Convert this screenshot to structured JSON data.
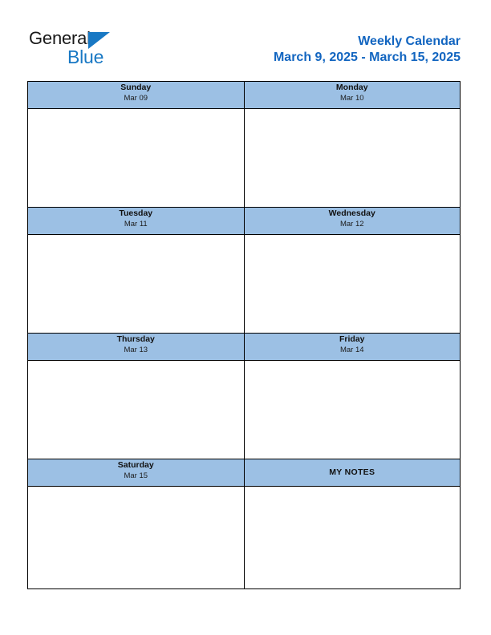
{
  "document": {
    "type": "weekly-calendar",
    "page_background": "#ffffff"
  },
  "brand": {
    "name_part1": "General",
    "name_part2": "Blue",
    "primary_color": "#1878c4",
    "text_color": "#191919",
    "triangle_icon": "triangle-icon"
  },
  "header": {
    "title": "Weekly Calendar",
    "date_range": "March 9, 2025 - March 15, 2025",
    "title_color": "#1265c0"
  },
  "calendar": {
    "header_background": "#9cc0e4",
    "border_color": "#000000",
    "cell_background": "#ffffff",
    "rows": [
      {
        "cells": [
          {
            "day": "Sunday",
            "date": "Mar 09",
            "content": ""
          },
          {
            "day": "Monday",
            "date": "Mar 10",
            "content": ""
          }
        ]
      },
      {
        "cells": [
          {
            "day": "Tuesday",
            "date": "Mar 11",
            "content": ""
          },
          {
            "day": "Wednesday",
            "date": "Mar 12",
            "content": ""
          }
        ]
      },
      {
        "cells": [
          {
            "day": "Thursday",
            "date": "Mar 13",
            "content": ""
          },
          {
            "day": "Friday",
            "date": "Mar 14",
            "content": ""
          }
        ]
      },
      {
        "cells": [
          {
            "day": "Saturday",
            "date": "Mar 15",
            "content": ""
          },
          {
            "day": "MY NOTES",
            "date": "",
            "content": ""
          }
        ]
      }
    ]
  }
}
